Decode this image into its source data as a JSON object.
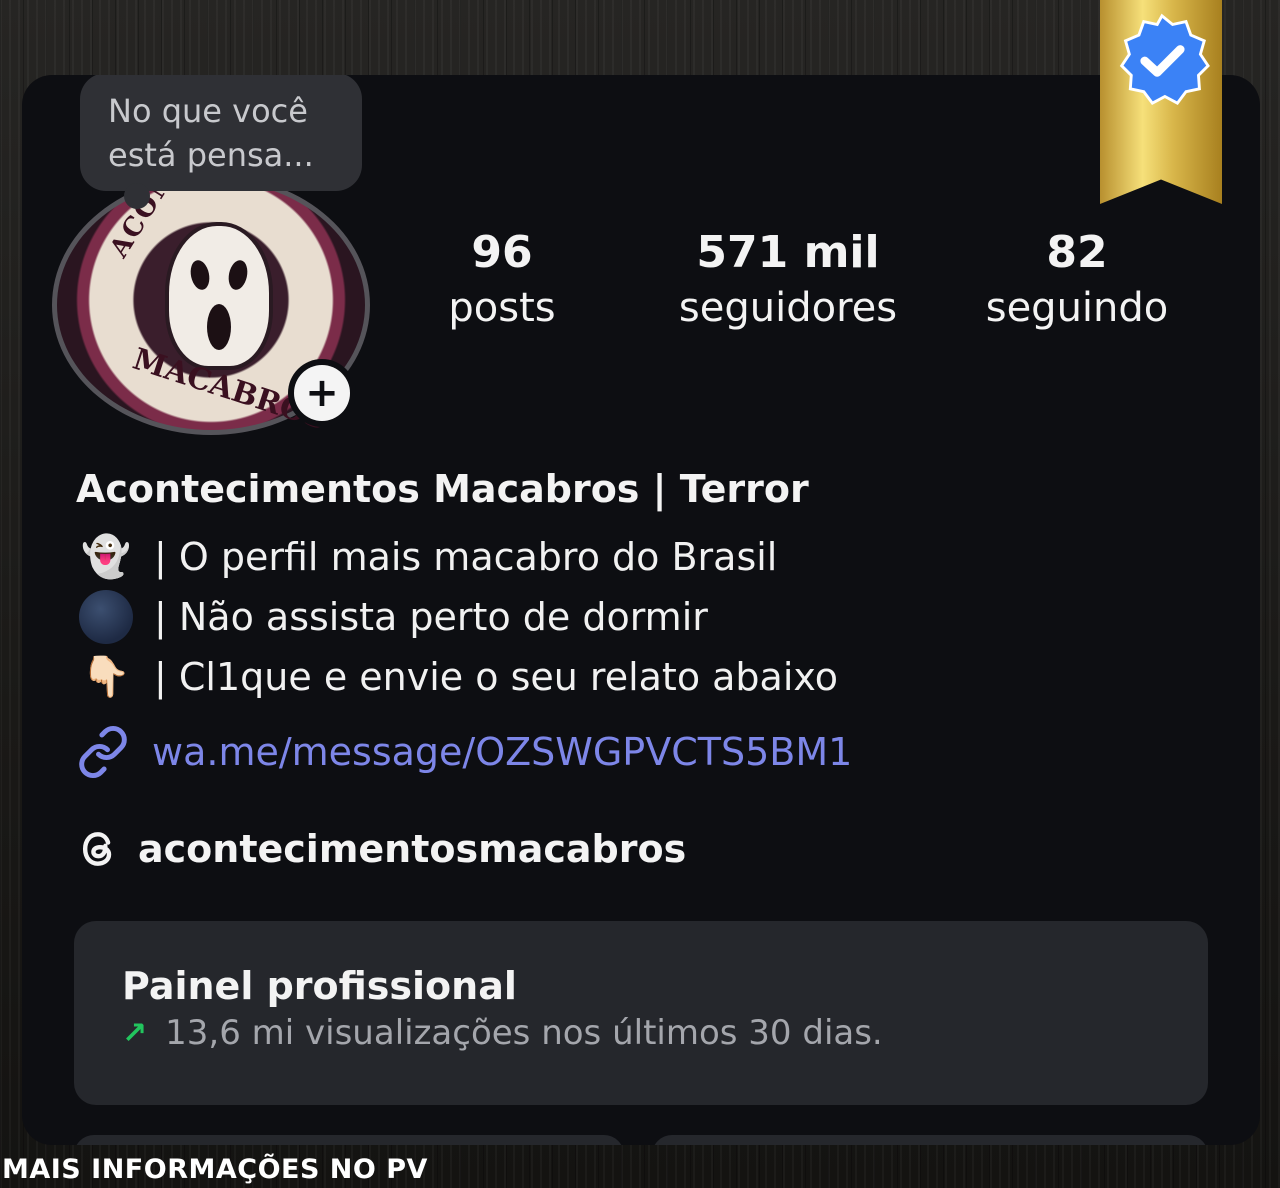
{
  "note": {
    "text": "No que você está pensa..."
  },
  "profile": {
    "avatar": {
      "top_text": "ACONTECIMENTOS",
      "bottom_text": "MACABROS"
    },
    "add_story_symbol": "+",
    "stats": [
      {
        "value": "96",
        "label": "posts"
      },
      {
        "value": "571 mil",
        "label": "seguidores"
      },
      {
        "value": "82",
        "label": "seguindo"
      }
    ],
    "name": "Acontecimentos Macabros | Terror",
    "bio": [
      {
        "icon": "ghost-emoji",
        "emoji": "👻",
        "text": "| O perfil mais macabro do Brasil"
      },
      {
        "icon": "new-moon-emoji",
        "emoji": "",
        "text": "| Não assista perto de dormir"
      },
      {
        "icon": "pointing-down-emoji",
        "emoji": "👇🏻",
        "text": "| Cl1que e envie o seu relato abaixo"
      }
    ],
    "link": {
      "icon": "link-icon",
      "text": "wa.me/message/OZSWGPVCTS5BM1"
    },
    "threads": {
      "icon": "threads-icon",
      "handle": "acontecimentosmacabros"
    }
  },
  "dashboard": {
    "title": "Painel profissional",
    "trend_icon": "trend-up-arrow-icon",
    "subtitle": "13,6 mi visualizações nos últimos 30 dias."
  },
  "verified_badge": {
    "icon": "verified-checkmark-icon"
  },
  "footer": {
    "text": "MAIS INFORMAÇÕES NO PV"
  },
  "colors": {
    "card_bg": "#0d0e12",
    "link": "#7d86e8",
    "trend": "#22c55e",
    "badge_blue": "#3b82f6",
    "ribbon_gold": "#d8b64a"
  }
}
